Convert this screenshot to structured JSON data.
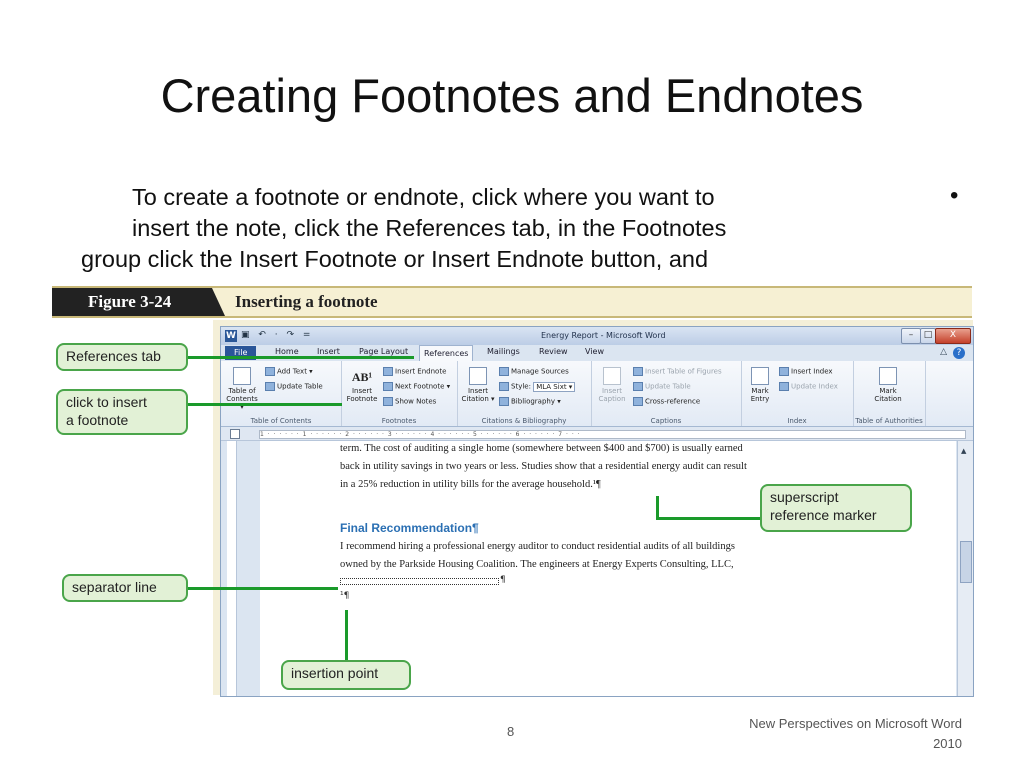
{
  "slide": {
    "title": "Creating Footnotes and Endnotes",
    "body_lines": [
      "To create a footnote or endnote, click where you want to",
      "insert the note, click the References tab, in the Footnotes",
      "group click the Insert Footnote or Insert Endnote button, and"
    ],
    "bullet": "•",
    "page_number": "8",
    "footer": "New Perspectives on Microsoft Word 2010"
  },
  "figure": {
    "tag": "Figure 3-24",
    "caption": "Inserting a footnote"
  },
  "word": {
    "app_icon": "W",
    "window_title": "Energy Report - Microsoft Word",
    "quick_access": "▣ ↶ · ↷ =",
    "window_buttons": [
      "–",
      "□",
      "X"
    ],
    "tabs": [
      "File",
      "Home",
      "Insert",
      "Page Layout",
      "References",
      "Mailings",
      "Review",
      "View"
    ],
    "active_tab": "References",
    "help": "?",
    "groups": [
      {
        "label": "Table of Contents",
        "big": [
          "Table of",
          "Contents ▾"
        ],
        "small": [
          "Add Text ▾",
          "Update Table"
        ]
      },
      {
        "label": "Footnotes",
        "big": [
          "Insert",
          "Footnote"
        ],
        "big_icon": "AB¹",
        "small": [
          "Insert Endnote",
          "Next Footnote ▾",
          "Show Notes"
        ]
      },
      {
        "label": "Citations & Bibliography",
        "big": [
          "Insert",
          "Citation ▾"
        ],
        "small": [
          "Manage Sources",
          "Style:",
          "MLA Sixt ▾",
          "Bibliography ▾"
        ]
      },
      {
        "label": "Captions",
        "big": [
          "Insert",
          "Caption"
        ],
        "small": [
          "Insert Table of Figures",
          "Update Table",
          "Cross-reference"
        ]
      },
      {
        "label": "Index",
        "big": [
          "Mark",
          "Entry"
        ],
        "small": [
          "Insert Index",
          "Update Index"
        ]
      },
      {
        "label": "Table of Authorities",
        "big": [
          "Mark",
          "Citation"
        ],
        "small": []
      }
    ],
    "ruler": "1 · · · · · · 1 · · · · · · 2 · · · · · · 3 · · · · · · 4 · · · · · · 5 · · · · · · 6 · · · · · · 7 · · ·",
    "doc_lines": [
      "term. The cost of auditing a single home (somewhere between $400 and $700) is usually earned",
      "back in utility savings in two years or less. Studies show that a residential energy audit can result",
      "in a 25% reduction in utility bills for the average household.¹¶"
    ],
    "heading": "Final Recommendation¶",
    "para_lines": [
      "I recommend hiring a professional energy auditor to conduct residential audits of all buildings",
      "owned by the Parkside Housing Coalition. The engineers at Energy Experts Consulting, LLC,"
    ],
    "separator_pilcrow": "¶",
    "footnote_marker": "¹¶"
  },
  "callouts": {
    "references_tab": "References tab",
    "click_insert": [
      "click to insert",
      "a footnote"
    ],
    "superscript": [
      "superscript",
      "reference marker"
    ],
    "separator": "separator line",
    "insertion": "insertion point"
  },
  "colors": {
    "callout_fill": "#e2f1d6",
    "callout_border": "#4aa54a",
    "arrow": "#1a9a2a",
    "heading_blue": "#2a6fb3",
    "figure_tag_bg": "#222222"
  }
}
